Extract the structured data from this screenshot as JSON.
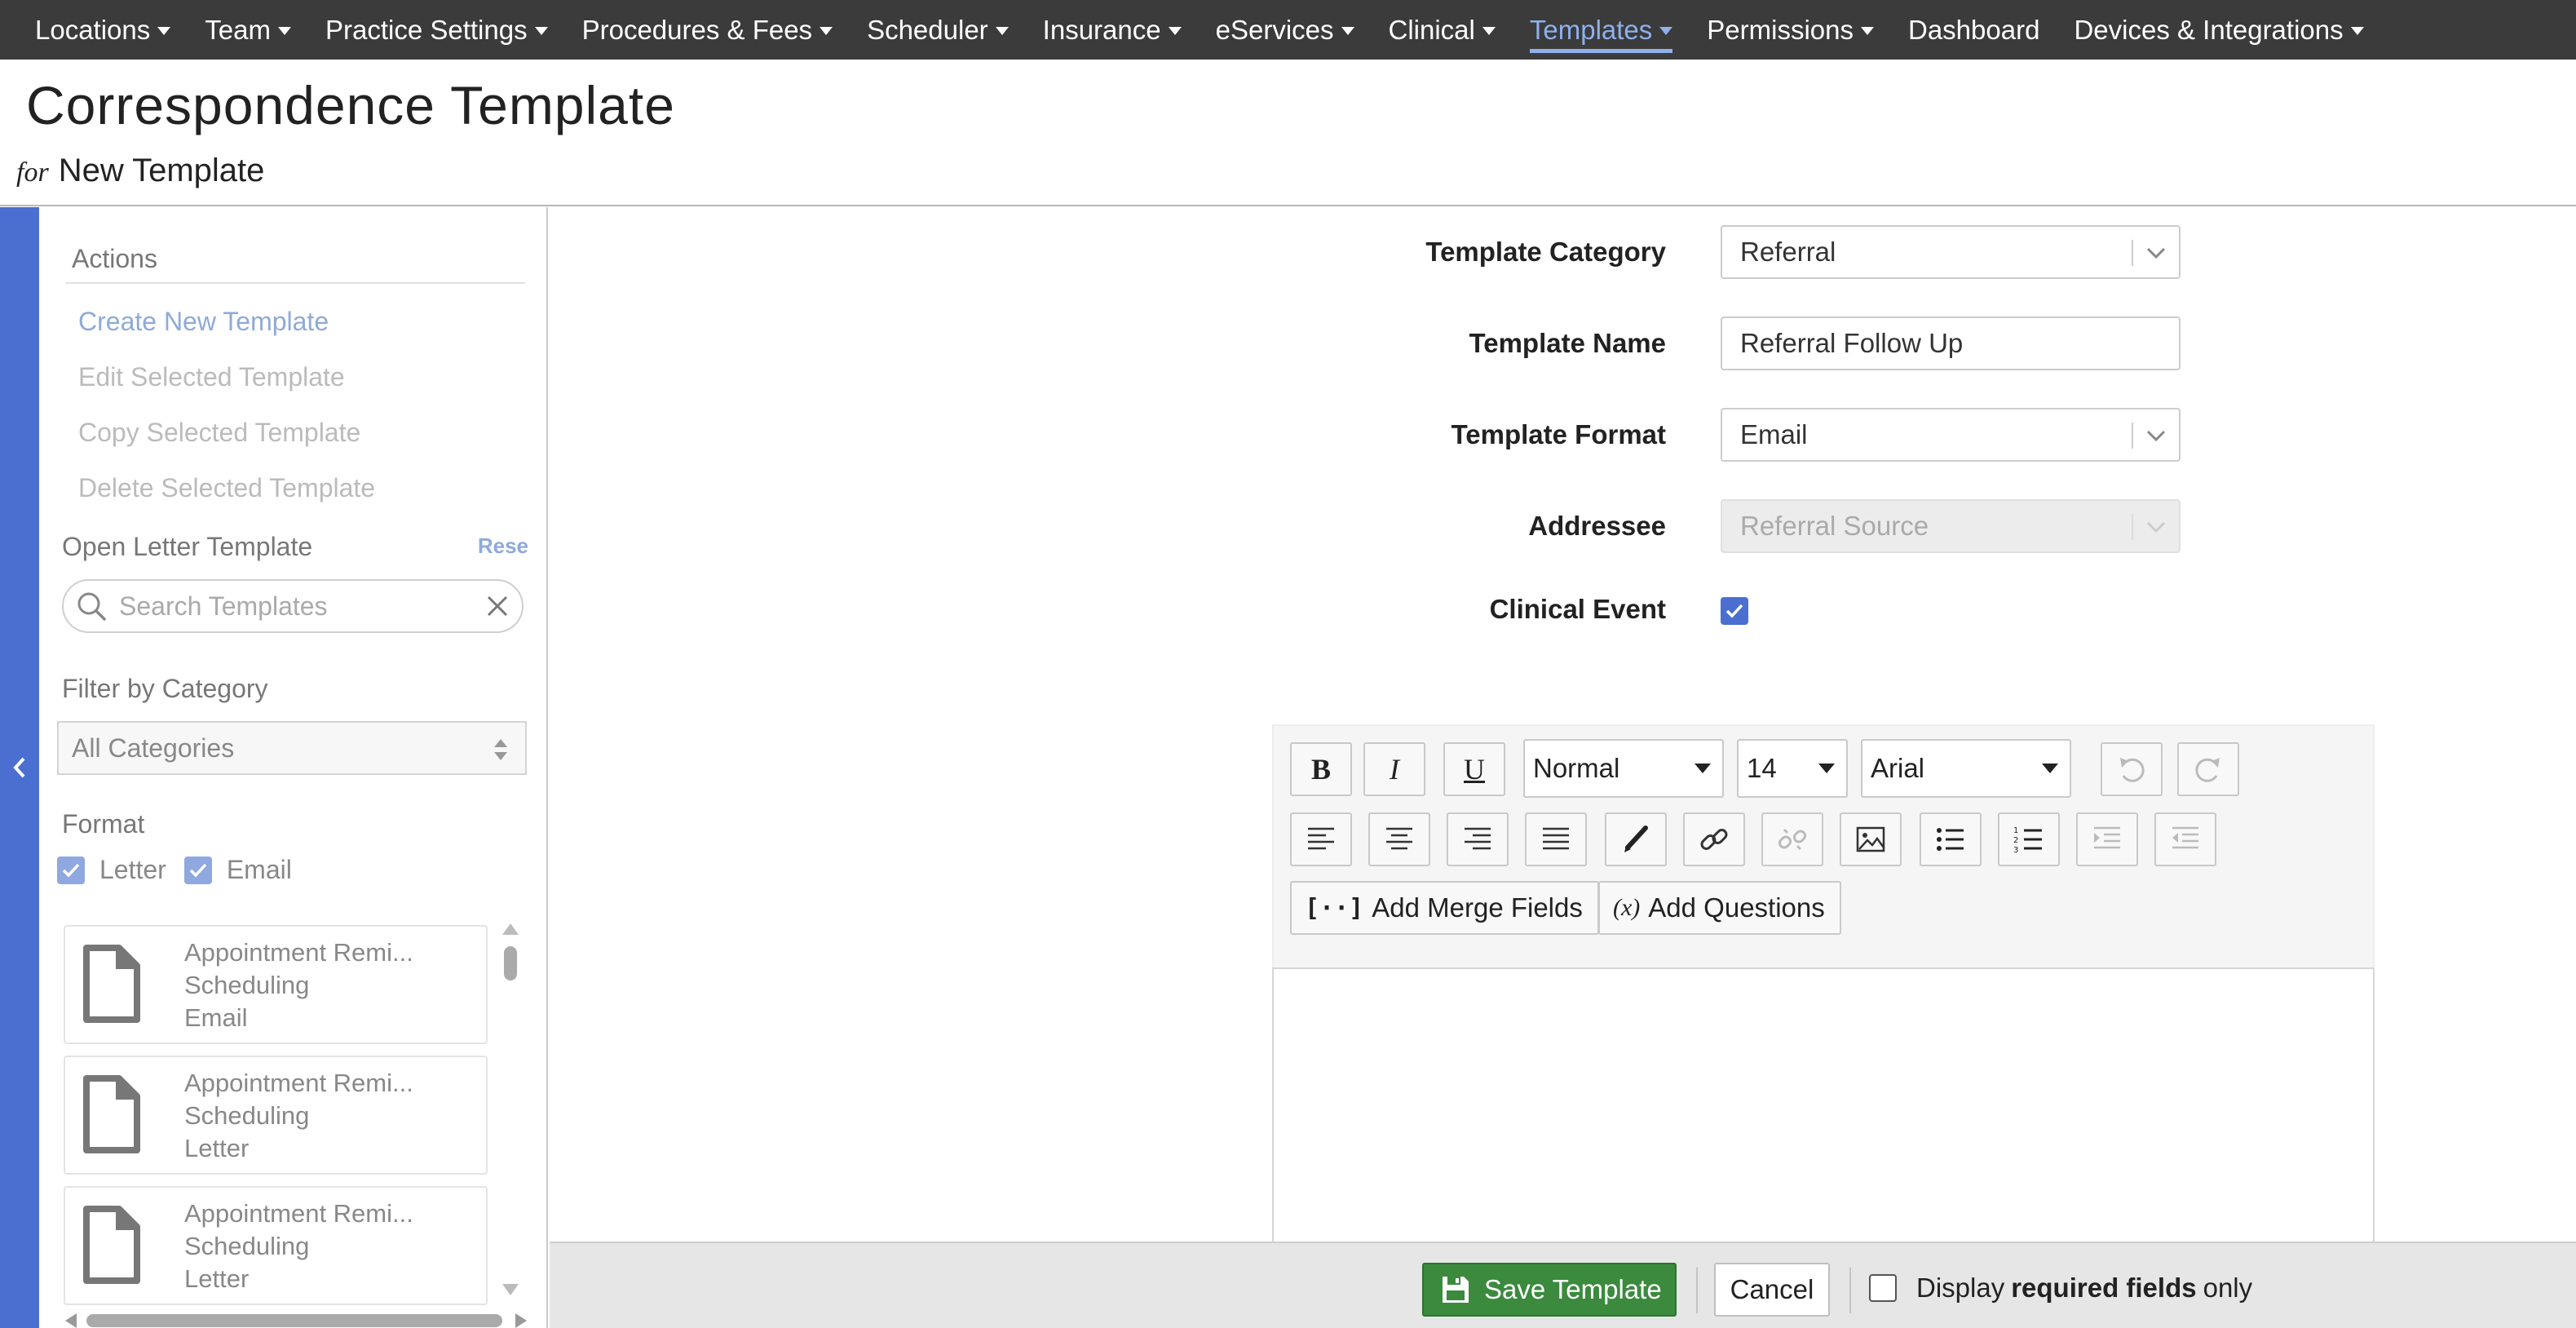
{
  "nav": {
    "items": [
      {
        "label": "Locations",
        "caret": true,
        "active": false
      },
      {
        "label": "Team",
        "caret": true,
        "active": false
      },
      {
        "label": "Practice Settings",
        "caret": true,
        "active": false
      },
      {
        "label": "Procedures & Fees",
        "caret": true,
        "active": false
      },
      {
        "label": "Scheduler",
        "caret": true,
        "active": false
      },
      {
        "label": "Insurance",
        "caret": true,
        "active": false
      },
      {
        "label": "eServices",
        "caret": true,
        "active": false
      },
      {
        "label": "Clinical",
        "caret": true,
        "active": false
      },
      {
        "label": "Templates",
        "caret": true,
        "active": true
      },
      {
        "label": "Permissions",
        "caret": true,
        "active": false
      },
      {
        "label": "Dashboard",
        "caret": false,
        "active": false
      },
      {
        "label": "Devices & Integrations",
        "caret": true,
        "active": false
      }
    ]
  },
  "header": {
    "title": "Correspondence Template",
    "for_prefix": "for",
    "subtitle": "New Template"
  },
  "sidebar": {
    "actions_heading": "Actions",
    "actions": [
      {
        "label": "Create New Template",
        "enabled": true
      },
      {
        "label": "Edit Selected Template",
        "enabled": false
      },
      {
        "label": "Copy Selected Template",
        "enabled": false
      },
      {
        "label": "Delete Selected Template",
        "enabled": false
      }
    ],
    "open_heading": "Open Letter Template",
    "reset_label": "Rese",
    "search_placeholder": "Search Templates",
    "filter_heading": "Filter by Category",
    "category_value": "All Categories",
    "format_heading": "Format",
    "format_options": [
      {
        "label": "Letter",
        "checked": true
      },
      {
        "label": "Email",
        "checked": true
      }
    ],
    "templates": [
      {
        "name": "Appointment Remi...",
        "category": "Scheduling",
        "format": "Email"
      },
      {
        "name": "Appointment Remi...",
        "category": "Scheduling",
        "format": "Letter"
      },
      {
        "name": "Appointment Remi...",
        "category": "Scheduling",
        "format": "Letter"
      }
    ]
  },
  "form": {
    "category_label": "Template Category",
    "category_value": "Referral",
    "name_label": "Template Name",
    "name_value": "Referral Follow Up",
    "format_label": "Template Format",
    "format_value": "Email",
    "addressee_label": "Addressee",
    "addressee_value": "Referral Source",
    "clinical_label": "Clinical Event",
    "clinical_checked": true
  },
  "editor": {
    "bold": "B",
    "italic": "I",
    "underline": "U",
    "style_value": "Normal",
    "size_value": "14",
    "font_value": "Arial",
    "merge_icon": "[⋅⋅]",
    "merge_label": "Add Merge Fields",
    "questions_icon": "(x)",
    "questions_label": "Add Questions"
  },
  "footer": {
    "save_label": "Save Template",
    "cancel_label": "Cancel",
    "req_prefix": "Display",
    "req_bold": "required fields",
    "req_suffix": "only"
  }
}
